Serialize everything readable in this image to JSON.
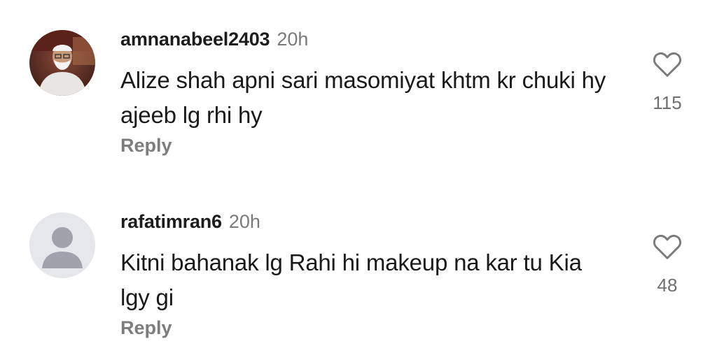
{
  "comments": [
    {
      "username": "amnanabeel2403",
      "time": "20h",
      "text": "Alize shah apni sari masomiyat khtm kr chuki hy ajeeb lg rhi hy",
      "reply_label": "Reply",
      "likes": "115",
      "avatar": "photo"
    },
    {
      "username": "rafatimran6",
      "time": "20h",
      "text": "Kitni bahanak lg Rahi hi makeup na kar tu Kia lgy gi",
      "reply_label": "Reply",
      "likes": "48",
      "avatar": "default-person-icon"
    }
  ],
  "colors": {
    "username": "#1c1c1c",
    "meta": "#7a7a7a",
    "reply": "#7d7d7d",
    "heart": "#7a7a7a",
    "default_avatar_bg": "#e6e7ea",
    "default_avatar_fg": "#a0a3ab"
  }
}
